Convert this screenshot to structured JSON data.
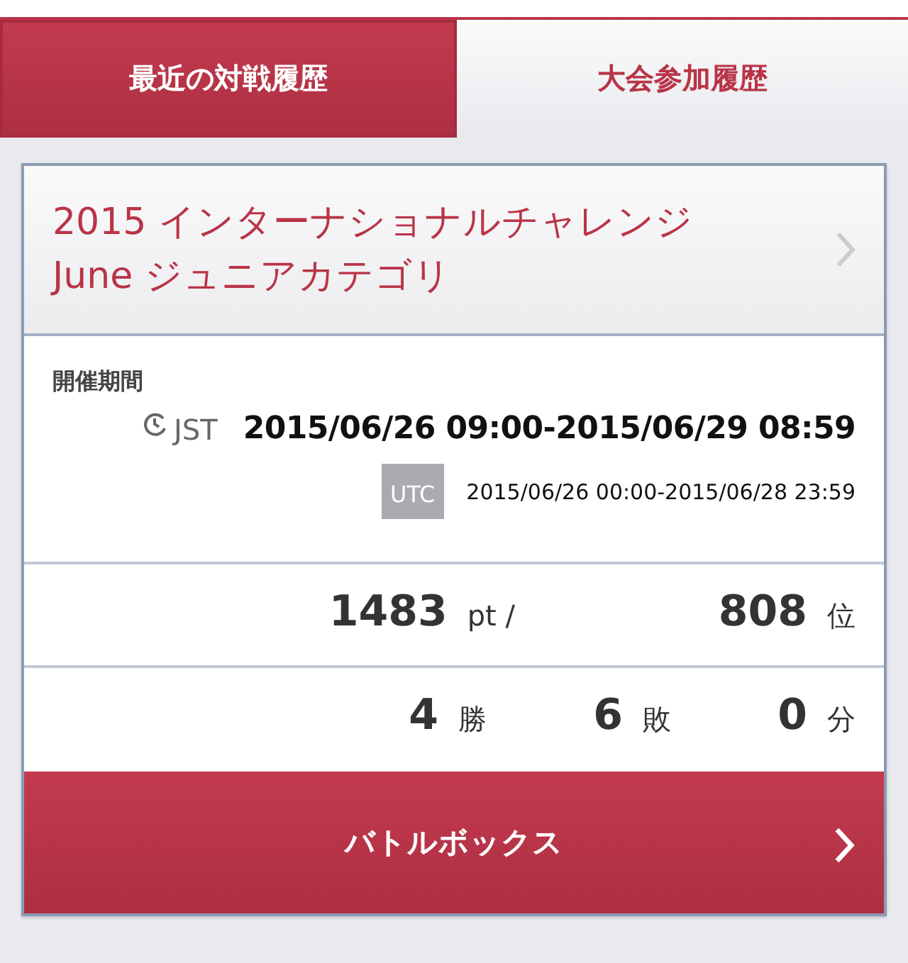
{
  "tabs": [
    {
      "label": "最近の対戦履歴",
      "selected": true
    },
    {
      "label": "大会参加履歴",
      "selected": false
    }
  ],
  "tournament": {
    "title": "2015 インターナショナルチャレンジ June ジュニアカテゴリ",
    "period": {
      "label": "開催期間",
      "local_zone": "JST",
      "local_range": "2015/06/26 09:00-2015/06/29 08:59",
      "utc_zone": "UTC",
      "utc_range": "2015/06/26 00:00-2015/06/28 23:59"
    },
    "score": [
      {
        "value": "1483",
        "unit": "pt /"
      },
      {
        "value": "808",
        "unit": "位"
      }
    ],
    "record": [
      {
        "value": "4",
        "unit": "勝"
      },
      {
        "value": "6",
        "unit": "敗"
      },
      {
        "value": "0",
        "unit": "分"
      }
    ],
    "button": "バトルボックス"
  }
}
